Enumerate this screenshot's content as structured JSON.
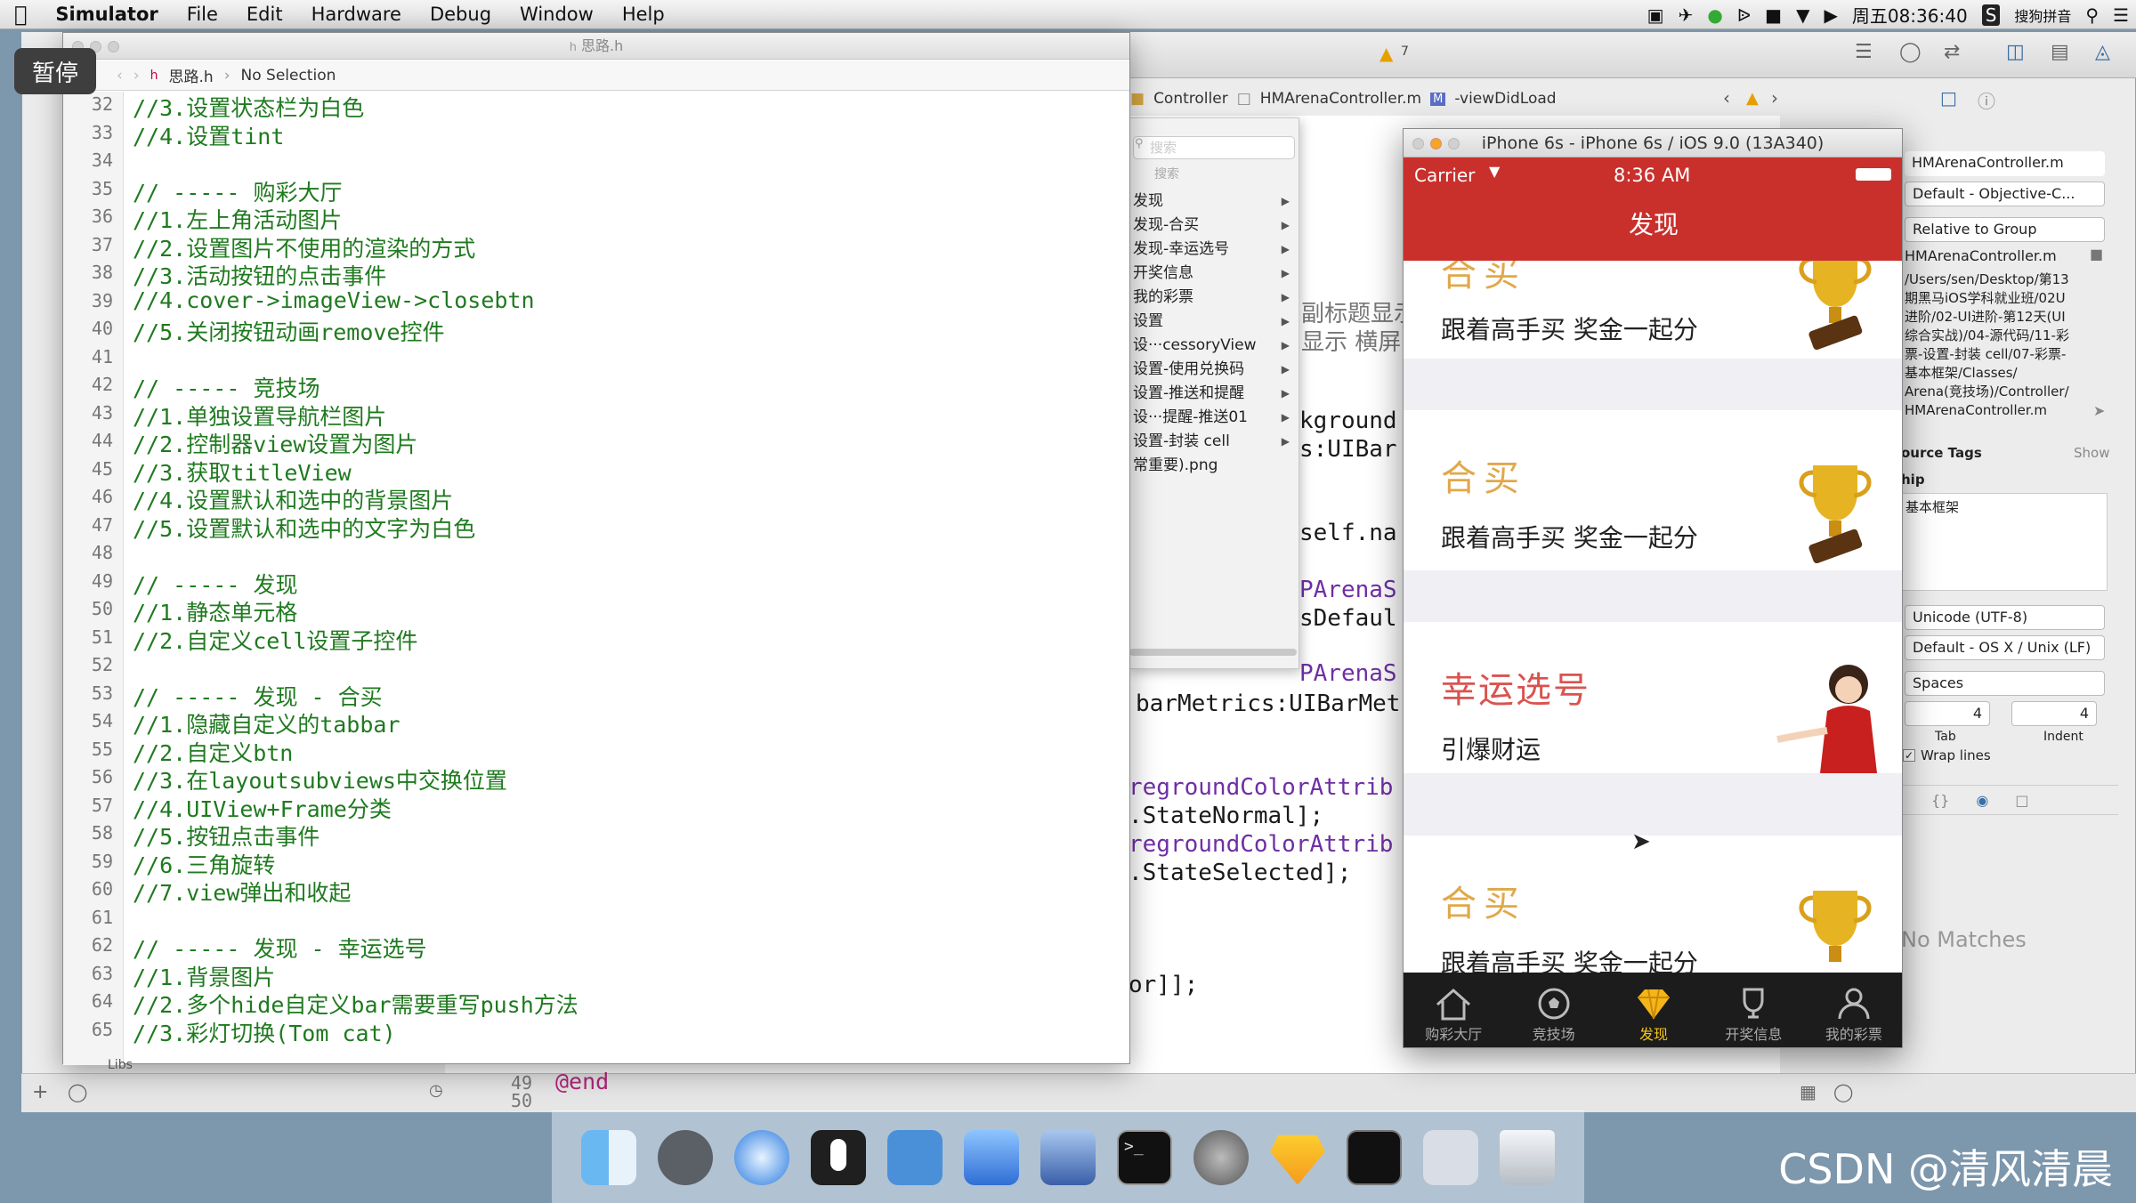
{
  "menubar": {
    "items": [
      "Simulator",
      "File",
      "Edit",
      "Hardware",
      "Debug",
      "Window",
      "Help"
    ],
    "clock": "周五08:36:40",
    "ime": "搜狗拼音"
  },
  "pause_label": "暂停",
  "xcode": {
    "warn_count": "7",
    "breadcrumb": [
      "Controller",
      "HMArenaController.m",
      "-viewDidLoad"
    ],
    "bg_code": [
      "kground",
      "s:UIBar",
      "self.na",
      "PArenaS",
      "sDefaul",
      "PArenaS",
      "barMetrics:UIBarMet",
      "regroundColorAttrib",
      ".StateNormal];",
      "regroundColorAttrib",
      ".StateSelected];",
      "or]];"
    ],
    "bg_side": [
      "副标题显示",
      "显示  横屏"
    ],
    "bottom_lines": [
      "49",
      "50"
    ],
    "end_kw": "@end",
    "libs": "Libs"
  },
  "editor": {
    "title": "思路.h",
    "jump_file": "思路.h",
    "jump_sel": "No Selection",
    "lines": [
      {
        "n": "32",
        "t": "//3.设置状态栏为白色"
      },
      {
        "n": "33",
        "t": "//4.设置tint"
      },
      {
        "n": "34",
        "t": ""
      },
      {
        "n": "35",
        "t": "// ----- 购彩大厅"
      },
      {
        "n": "36",
        "t": "//1.左上角活动图片"
      },
      {
        "n": "37",
        "t": "//2.设置图片不使用的渲染的方式"
      },
      {
        "n": "38",
        "t": "//3.活动按钮的点击事件"
      },
      {
        "n": "39",
        "t": "//4.cover->imageView->closebtn"
      },
      {
        "n": "40",
        "t": "//5.关闭按钮动画remove控件"
      },
      {
        "n": "41",
        "t": ""
      },
      {
        "n": "42",
        "t": "// ----- 竞技场"
      },
      {
        "n": "43",
        "t": "//1.单独设置导航栏图片"
      },
      {
        "n": "44",
        "t": "//2.控制器view设置为图片"
      },
      {
        "n": "45",
        "t": "//3.获取titleView"
      },
      {
        "n": "46",
        "t": "//4.设置默认和选中的背景图片"
      },
      {
        "n": "47",
        "t": "//5.设置默认和选中的文字为白色"
      },
      {
        "n": "48",
        "t": ""
      },
      {
        "n": "49",
        "t": "// ----- 发现"
      },
      {
        "n": "50",
        "t": "//1.静态单元格"
      },
      {
        "n": "51",
        "t": "//2.自定义cell设置子控件"
      },
      {
        "n": "52",
        "t": ""
      },
      {
        "n": "53",
        "t": "// ----- 发现 - 合买"
      },
      {
        "n": "54",
        "t": "//1.隐藏自定义的tabbar"
      },
      {
        "n": "55",
        "t": "//2.自定义btn"
      },
      {
        "n": "56",
        "t": "//3.在layoutsubviews中交换位置"
      },
      {
        "n": "57",
        "t": "//4.UIView+Frame分类"
      },
      {
        "n": "58",
        "t": "//5.按钮点击事件"
      },
      {
        "n": "59",
        "t": "//6.三角旋转"
      },
      {
        "n": "60",
        "t": "//7.view弹出和收起"
      },
      {
        "n": "61",
        "t": ""
      },
      {
        "n": "62",
        "t": "// ----- 发现 - 幸运选号"
      },
      {
        "n": "63",
        "t": "//1.背景图片"
      },
      {
        "n": "64",
        "t": "//2.多个hide自定义bar需要重写push方法"
      },
      {
        "n": "65",
        "t": "//3.彩灯切换(Tom cat)"
      }
    ]
  },
  "popup": {
    "search_placeholder": "搜索",
    "search_label": "搜索",
    "items": [
      "发现",
      "发现-合买",
      "发现-幸运选号",
      "开奖信息",
      "我的彩票",
      "设置",
      "设···cessoryView",
      "设置-使用兑换码",
      "设置-推送和提醒",
      "设···提醒-推送01",
      "设置-封装 cell",
      "常重要).png"
    ]
  },
  "inspector": {
    "name": "HMArenaController.m",
    "type": "Default - Objective-C...",
    "location": "Relative to Group",
    "filename": "HMArenaController.m",
    "fullpath": [
      "/Users/sen/Desktop/第13",
      "期黑马iOS学科就业班/02U",
      "进阶/02-UI进阶-第12天(UI",
      "综合实战)/04-源代码/11-彩",
      "票-设置-封装 cell/07-彩票-",
      "基本框架/Classes/",
      "Arena(竞技场)/Controller/",
      "HMArenaController.m"
    ],
    "source_tags": "ource Tags",
    "show": "Show",
    "ship": "hip",
    "framework": "基本框架",
    "encoding": "Unicode (UTF-8)",
    "line_endings": "Default - OS X / Unix (LF)",
    "indent_using": "Spaces",
    "tab_width": "4",
    "indent_width": "4",
    "tab_label": "Tab",
    "indent_label": "Indent",
    "wrap_lines": "Wrap lines",
    "no_matches": "No Matches"
  },
  "simulator": {
    "title": "iPhone 6s - iPhone 6s / iOS 9.0 (13A340)",
    "carrier": "Carrier",
    "time": "8:36 AM",
    "nav_title": "发现",
    "cells": [
      {
        "title": "合买",
        "subtitle": "跟着高手买 奖金一起分"
      },
      {
        "title": "合买",
        "subtitle": "跟着高手买 奖金一起分"
      },
      {
        "title": "幸运选号",
        "subtitle": "引爆财运"
      },
      {
        "title": "合买",
        "subtitle": "跟着高手买 奖金一起分"
      }
    ],
    "tabs": [
      "购彩大厅",
      "竞技场",
      "发现",
      "开奖信息",
      "我的彩票"
    ],
    "active_tab": 2,
    "accent": "#c9302c",
    "tab_active_color": "#f5c518"
  },
  "watermark": "CSDN @清风清晨"
}
